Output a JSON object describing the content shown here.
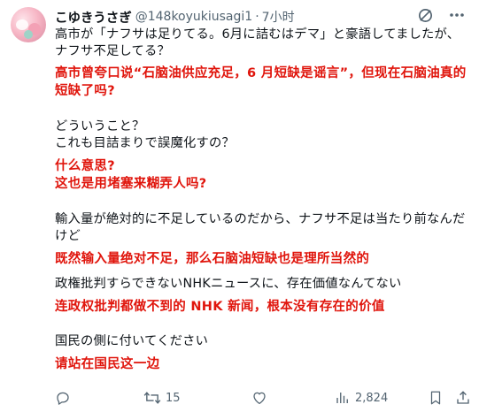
{
  "author": {
    "display_name": "こゆきうさぎ",
    "handle": "@148koyukiusagi1",
    "separator": "·",
    "time": "7小时"
  },
  "header_icons": [
    "grok-icon",
    "more-icon"
  ],
  "content": {
    "p1_jp": "高市が「ナフサは足りてる。6月に詰むはデマ」と豪語してましたが、ナフサ不足してる？",
    "p1_tr": "高市曾夸口说“石脑油供应充足，6 月短缺是谣言”，但现在石脑油真的短缺了吗?",
    "p2_jp_line1": "どういうこと？",
    "p2_jp_line2": "これも目詰まりで誤魔化すの？",
    "p2_tr_line1": "什么意思?",
    "p2_tr_line2": "这也是用堵塞来糊弄人吗?",
    "p3_jp": "輸入量が絶対的に不足しているのだから、ナフサ不足は当たり前なんだけど",
    "p3_tr": "既然输入量绝对不足，那么石脑油短缺也是理所当然的",
    "p4_jp": "政権批判すらできないNHKニュースに、存在価値なんてない",
    "p4_tr": "连政权批判都做不到的 NHK 新闻，根本没有存在的价值",
    "p5_jp": "国民の側に付いてください",
    "p5_tr": "请站在国民这一边"
  },
  "actions": {
    "reply_count": "",
    "repost_count": "15",
    "like_count": "",
    "views_count": "2,824"
  },
  "colors": {
    "text": "#0f1419",
    "secondary": "#536471",
    "translation": "#e0150c"
  }
}
